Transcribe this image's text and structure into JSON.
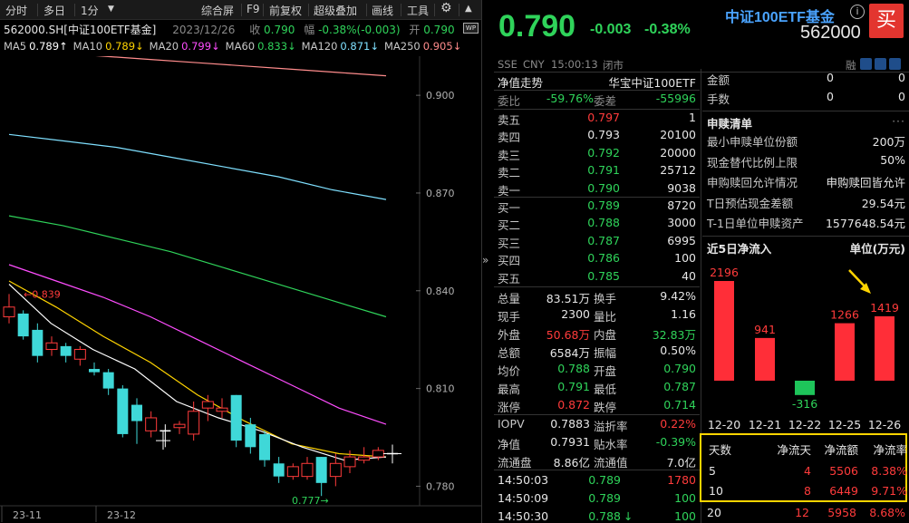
{
  "toolbar": {
    "items": [
      "分时",
      "多日",
      "1分",
      "综合屏",
      "F9",
      "前复权",
      "超级叠加",
      "画线",
      "工具"
    ],
    "gear_icon": "gear-icon",
    "arrow_icon": "chevron-up-icon"
  },
  "header": {
    "symbol": "562000.SH[中证100ETF基金]",
    "date": "2023/12/26",
    "close_label": "收",
    "close_value": "0.790",
    "change_label": "幅",
    "change_value": "-0.38%(-0.003)",
    "open_label": "开",
    "open_value": "0.790",
    "badge": "WP"
  },
  "ma_line": [
    {
      "label": "MA5",
      "value": "0.789↑",
      "color": "#ffffff"
    },
    {
      "label": "MA10",
      "value": "0.789↓",
      "color": "#ffd400"
    },
    {
      "label": "MA20",
      "value": "0.799↓",
      "color": "#ff4dff"
    },
    {
      "label": "MA60",
      "value": "0.833↓",
      "color": "#2fd35a"
    },
    {
      "label": "MA120",
      "value": "0.871↓",
      "color": "#7fe0ff"
    },
    {
      "label": "MA250",
      "value": "0.905↓",
      "color": "#ff8c8c"
    }
  ],
  "chart": {
    "y_ticks": [
      "0.900",
      "0.870",
      "0.840",
      "0.810",
      "0.780"
    ],
    "x_ticks": [
      "23-11",
      "23-12"
    ],
    "high_label": "0.839",
    "low_label": "0.777"
  },
  "quote": {
    "price": "0.790",
    "change": "-0.003",
    "change_pct": "-0.38%",
    "name": "中证100ETF基金",
    "code": "562000",
    "buy_label": "买",
    "info_icon": "i"
  },
  "sub_bar": {
    "market": "SSE",
    "currency": "CNY",
    "time": "15:00:13",
    "status": "闭市",
    "rong": "融"
  },
  "nav": {
    "label": "净值走势",
    "provider": "华宝中证100ETF"
  },
  "weibi": {
    "k1": "委比",
    "v1": "-59.76%",
    "k2": "委差",
    "v2": "-55996"
  },
  "asks": [
    {
      "label": "卖五",
      "price": "0.797",
      "vol": "1",
      "color": "#ff3b3b"
    },
    {
      "label": "卖四",
      "price": "0.793",
      "vol": "20100",
      "color": "#e6e6e6"
    },
    {
      "label": "卖三",
      "price": "0.792",
      "vol": "20000",
      "color": "#2fd35a"
    },
    {
      "label": "卖二",
      "price": "0.791",
      "vol": "25712",
      "color": "#2fd35a"
    },
    {
      "label": "卖一",
      "price": "0.790",
      "vol": "9038",
      "color": "#2fd35a"
    }
  ],
  "bids": [
    {
      "label": "买一",
      "price": "0.789",
      "vol": "8720",
      "color": "#2fd35a"
    },
    {
      "label": "买二",
      "price": "0.788",
      "vol": "3000",
      "color": "#2fd35a"
    },
    {
      "label": "买三",
      "price": "0.787",
      "vol": "6995",
      "color": "#2fd35a"
    },
    {
      "label": "买四",
      "price": "0.786",
      "vol": "100",
      "color": "#2fd35a"
    },
    {
      "label": "买五",
      "price": "0.785",
      "vol": "40",
      "color": "#2fd35a"
    }
  ],
  "stats": [
    {
      "k1": "总量",
      "v1": "83.51万",
      "c1": "#e6e6e6",
      "k2": "换手",
      "v2": "9.42%",
      "c2": "#e6e6e6"
    },
    {
      "k1": "现手",
      "v1": "2300",
      "c1": "#e6e6e6",
      "k2": "量比",
      "v2": "1.16",
      "c2": "#e6e6e6"
    },
    {
      "k1": "外盘",
      "v1": "50.68万",
      "c1": "#ff3b3b",
      "k2": "内盘",
      "v2": "32.83万",
      "c2": "#2fd35a"
    },
    {
      "k1": "总额",
      "v1": "6584万",
      "c1": "#e6e6e6",
      "k2": "振幅",
      "v2": "0.50%",
      "c2": "#e6e6e6"
    },
    {
      "k1": "均价",
      "v1": "0.788",
      "c1": "#2fd35a",
      "k2": "开盘",
      "v2": "0.790",
      "c2": "#2fd35a"
    },
    {
      "k1": "最高",
      "v1": "0.791",
      "c1": "#2fd35a",
      "k2": "最低",
      "v2": "0.787",
      "c2": "#2fd35a"
    },
    {
      "k1": "涨停",
      "v1": "0.872",
      "c1": "#ff3b3b",
      "k2": "跌停",
      "v2": "0.714",
      "c2": "#2fd35a"
    }
  ],
  "iopv": [
    {
      "k1": "IOPV",
      "v1": "0.7883",
      "c1": "#e6e6e6",
      "k2": "溢折率",
      "v2": "0.22%",
      "c2": "#ff3b3b"
    },
    {
      "k1": "净值",
      "v1": "0.7931",
      "c1": "#e6e6e6",
      "k2": "贴水率",
      "v2": "-0.39%",
      "c2": "#2fd35a"
    },
    {
      "k1": "流通盘",
      "v1": "8.86亿",
      "c1": "#e6e6e6",
      "k2": "流通值",
      "v2": "7.0亿",
      "c2": "#e6e6e6"
    }
  ],
  "ticks": [
    {
      "time": "14:50:03",
      "price": "0.789",
      "vol": "1780",
      "vcolor": "#ff3b3b",
      "arrow": ""
    },
    {
      "time": "14:50:09",
      "price": "0.789",
      "vol": "100",
      "vcolor": "#2fd35a",
      "arrow": ""
    },
    {
      "time": "14:50:30",
      "price": "0.788",
      "vol": "100",
      "vcolor": "#2fd35a",
      "arrow": "↓"
    }
  ],
  "purchase": {
    "top": [
      {
        "k": "金额",
        "v1": "0",
        "v2": "0"
      },
      {
        "k": "手数",
        "v1": "0",
        "v2": "0"
      }
    ],
    "title": "申赎清单",
    "items": [
      {
        "k": "最小申赎单位份额",
        "v": "200万"
      },
      {
        "k": "现金替代比例上限",
        "v": "50%"
      },
      {
        "k": "申购赎回允许情况",
        "v": "申购赎回皆允许"
      },
      {
        "k": "T日预估现金差额",
        "v": "29.54元"
      },
      {
        "k": "T-1日单位申赎资产",
        "v": "1577648.54元"
      }
    ]
  },
  "flow": {
    "title": "近5日净流入",
    "unit": "单位(万元)",
    "chart_data": {
      "type": "bar",
      "categories": [
        "12-20",
        "12-21",
        "12-22",
        "12-25",
        "12-26"
      ],
      "values": [
        2196,
        941,
        -316,
        1266,
        1419
      ],
      "title": "近5日净流入",
      "ylabel": "单位(万元)"
    },
    "table": {
      "headers": [
        "天数",
        "净流天",
        "净流额",
        "净流率"
      ],
      "rows": [
        [
          "5",
          "4",
          "5506",
          "8.38%"
        ],
        [
          "10",
          "8",
          "6449",
          "9.71%"
        ],
        [
          "20",
          "12",
          "5958",
          "8.68%"
        ]
      ]
    }
  },
  "kline": {
    "chart_data": {
      "type": "candlestick",
      "title": "562000.SH[中证100ETF基金]",
      "ylim": [
        0.774,
        0.912
      ],
      "candles": [
        {
          "o": 0.832,
          "c": 0.835,
          "h": 0.839,
          "l": 0.83
        },
        {
          "o": 0.833,
          "c": 0.826,
          "h": 0.834,
          "l": 0.825
        },
        {
          "o": 0.828,
          "c": 0.82,
          "h": 0.83,
          "l": 0.818
        },
        {
          "o": 0.822,
          "c": 0.824,
          "h": 0.826,
          "l": 0.82
        },
        {
          "o": 0.823,
          "c": 0.82,
          "h": 0.824,
          "l": 0.818
        },
        {
          "o": 0.819,
          "c": 0.822,
          "h": 0.823,
          "l": 0.817
        },
        {
          "o": 0.816,
          "c": 0.815,
          "h": 0.818,
          "l": 0.814
        },
        {
          "o": 0.815,
          "c": 0.81,
          "h": 0.816,
          "l": 0.808
        },
        {
          "o": 0.81,
          "c": 0.796,
          "h": 0.811,
          "l": 0.795
        },
        {
          "o": 0.805,
          "c": 0.8,
          "h": 0.807,
          "l": 0.793
        },
        {
          "o": 0.797,
          "c": 0.801,
          "h": 0.803,
          "l": 0.795
        },
        {
          "o": 0.797,
          "c": 0.797,
          "h": 0.799,
          "l": 0.792
        },
        {
          "o": 0.798,
          "c": 0.799,
          "h": 0.8,
          "l": 0.796
        },
        {
          "o": 0.796,
          "c": 0.803,
          "h": 0.806,
          "l": 0.794
        },
        {
          "o": 0.804,
          "c": 0.806,
          "h": 0.808,
          "l": 0.8
        },
        {
          "o": 0.803,
          "c": 0.804,
          "h": 0.807,
          "l": 0.801
        },
        {
          "o": 0.808,
          "c": 0.794,
          "h": 0.808,
          "l": 0.792
        },
        {
          "o": 0.799,
          "c": 0.792,
          "h": 0.801,
          "l": 0.79
        },
        {
          "o": 0.796,
          "c": 0.788,
          "h": 0.797,
          "l": 0.786
        },
        {
          "o": 0.787,
          "c": 0.783,
          "h": 0.789,
          "l": 0.781
        },
        {
          "o": 0.783,
          "c": 0.786,
          "h": 0.787,
          "l": 0.782
        },
        {
          "o": 0.783,
          "c": 0.787,
          "h": 0.789,
          "l": 0.782
        },
        {
          "o": 0.789,
          "c": 0.781,
          "h": 0.789,
          "l": 0.777
        },
        {
          "o": 0.783,
          "c": 0.787,
          "h": 0.79,
          "l": 0.78
        },
        {
          "o": 0.786,
          "c": 0.789,
          "h": 0.791,
          "l": 0.784
        },
        {
          "o": 0.788,
          "c": 0.789,
          "h": 0.792,
          "l": 0.787
        },
        {
          "o": 0.789,
          "c": 0.791,
          "h": 0.792,
          "l": 0.788
        },
        {
          "o": 0.79,
          "c": 0.79,
          "h": 0.791,
          "l": 0.787
        }
      ],
      "ma250": [
        0.914,
        0.913,
        0.912,
        0.911,
        0.91,
        0.909,
        0.908,
        0.907,
        0.906
      ],
      "ma120": [
        0.888,
        0.886,
        0.884,
        0.881,
        0.878,
        0.875,
        0.871,
        0.868
      ],
      "ma60": [
        0.863,
        0.86,
        0.856,
        0.852,
        0.847,
        0.842,
        0.837,
        0.832
      ],
      "ma20": [
        0.848,
        0.843,
        0.838,
        0.832,
        0.825,
        0.818,
        0.811,
        0.804,
        0.799
      ],
      "ma10": [
        0.843,
        0.835,
        0.826,
        0.818,
        0.808,
        0.8,
        0.793,
        0.79,
        0.789
      ],
      "ma5": [
        0.842,
        0.83,
        0.822,
        0.816,
        0.806,
        0.801,
        0.797,
        0.792,
        0.788,
        0.789
      ]
    }
  }
}
